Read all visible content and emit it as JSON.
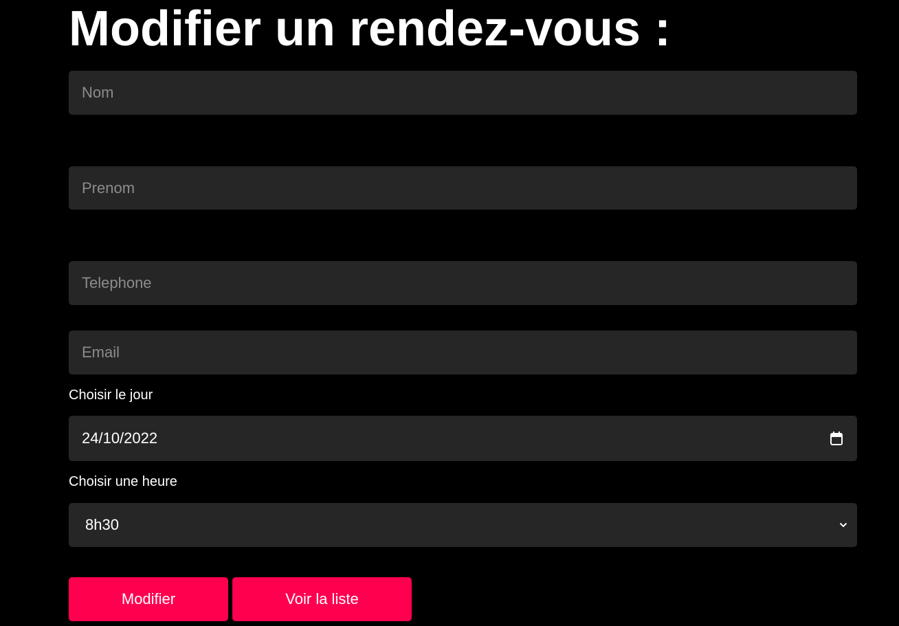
{
  "page": {
    "title": "Modifier un rendez-vous :"
  },
  "form": {
    "nom": {
      "placeholder": "Nom",
      "value": ""
    },
    "prenom": {
      "placeholder": "Prenom",
      "value": ""
    },
    "telephone": {
      "placeholder": "Telephone",
      "value": ""
    },
    "email": {
      "placeholder": "Email",
      "value": ""
    },
    "jour": {
      "label": "Choisir le jour",
      "value": "24/10/2022"
    },
    "heure": {
      "label": "Choisir une heure",
      "selected": "8h30"
    }
  },
  "actions": {
    "modifier_label": "Modifier",
    "voir_liste_label": "Voir la liste"
  },
  "colors": {
    "background": "#000000",
    "field_bg": "#262626",
    "accent": "#ff004f",
    "placeholder": "#8c8c8c"
  },
  "icons": {
    "date_picker": "calendar-icon",
    "select_arrow": "chevron-down-icon"
  }
}
